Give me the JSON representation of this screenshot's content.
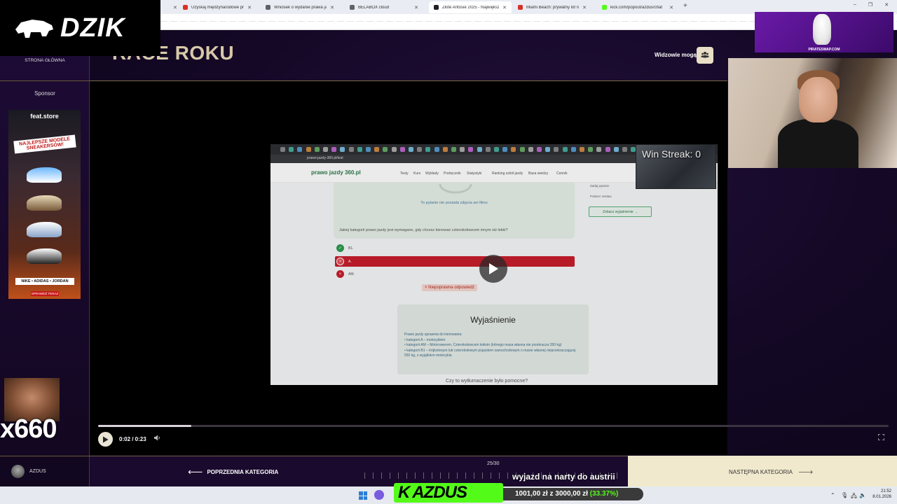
{
  "browser": {
    "tabs": [
      {
        "title": "Uzyskaj międzynarodowe praw",
        "color": "#d93025",
        "active": false
      },
      {
        "title": "Wniosek o wydanie prawa jazdy",
        "color": "#5f6368",
        "active": false
      },
      {
        "title": "BELABOX cloud",
        "color": "#5f6368",
        "active": false
      },
      {
        "title": "Złote Antosie 2025 - Największ",
        "color": "#202124",
        "active": true
      },
      {
        "title": "Miami Beach: prywatny lot nad",
        "color": "#d93025",
        "active": false
      },
      {
        "title": "kick.com/popout/azdus/chat",
        "color": "#53fc18",
        "active": false
      }
    ],
    "new_tab": "+",
    "window_controls": [
      "–",
      "❐",
      "✕"
    ]
  },
  "site": {
    "heading": "RACE ROKU",
    "viewers_label": "Widzowie mogą",
    "nav_home": "STRONA GŁÓWNA",
    "sponsor_label": "Sponsor",
    "user": "AZDUS",
    "prev_category": "POPRZEDNIA KATEGORIA",
    "next_category": "NASTĘPNA KATEGORIA",
    "counter": "25/30"
  },
  "player": {
    "time": "0:02 / 0:23",
    "progress": 0.118
  },
  "video": {
    "url": "prawo-jazdy-360.pl/test",
    "logo": "prawo jazdy 360.pl",
    "nav_links": [
      "Testy",
      "Kurs",
      "Wykłady",
      "Podręcznik",
      "Statystyki",
      "Ranking szkół jazdy",
      "Baza wiedzy",
      "Cennik"
    ],
    "film_note": "To pytanie nie posiada zdjęcia ani filmu",
    "question": "Jakiej kategorii prawo jazdy jest wymagane, gdy chcesz kierować czterokołowcem innym niż lekki?",
    "options": [
      {
        "label": "B1.",
        "state": "correct"
      },
      {
        "label": "A.",
        "state": "wrong-selected"
      },
      {
        "label": "AM.",
        "state": "wrong"
      }
    ],
    "feedback": "× Niepoprawna odpowiedź",
    "explain_title": "Wyjaśnienie",
    "explain_lines": [
      "Prawo jazdy uprawnia do kierowania:",
      "• kategorii A – motocyklem",
      "• kategorii AM – Motorowerem, Czterokołowcem lekkim (którego masa własna nie przekracza 350 kg)",
      "• kategorii B1 – trójkołowym lub czterokołowym pojazdem samochodowym o masie własnej nieprzekraczającej 550 kg, z wyjątkiem motocykla"
    ],
    "helpful": "Czy to wytłumaczenie było pomocne?",
    "side_items": [
      "Zadaj pytanie",
      "Pobierz zestaw"
    ],
    "side_button": "Zobacz wyjaśnienie →",
    "win_streak": "Win Streak: 0"
  },
  "overlay": {
    "brand": "DZIK",
    "ad_store": "feat.store",
    "ad_headline": "NAJLEPSZE MODELE SNEAKERSÓW!",
    "ad_brands": "NIKE • ADIDAS • JORDAN",
    "ad_cta": "SPRAWDŹ TERAZ",
    "multiplier": "x660",
    "pirate_label": "PIRATESWAP.COM",
    "kick_name": "AZDUS",
    "goal_text": "1001,00 zł z 3000,00 zł",
    "goal_pct": "(33.37%)",
    "marquee": "wyjazd na narty do austrii"
  },
  "taskbar": {
    "time": "21:52",
    "date": "8.01.2026"
  },
  "colors": {
    "accent_gold": "#d8c9a8",
    "kick_green": "#53fc18",
    "wrong_red": "#c81e2c",
    "correct_green": "#2e9b4f"
  }
}
